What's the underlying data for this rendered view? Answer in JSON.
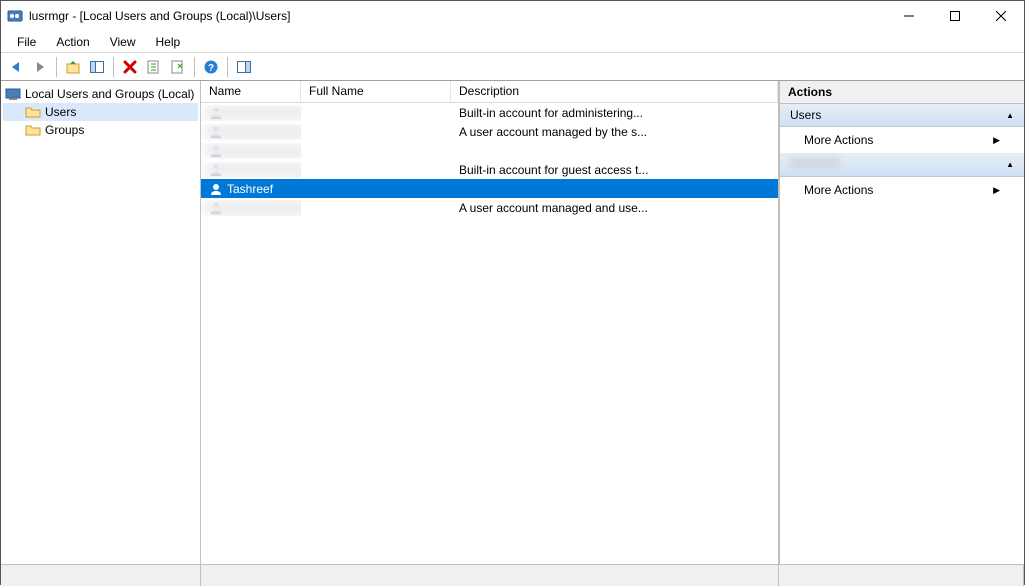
{
  "window": {
    "title": "lusrmgr - [Local Users and Groups (Local)\\Users]"
  },
  "menu": {
    "file": "File",
    "action": "Action",
    "view": "View",
    "help": "Help"
  },
  "tree": {
    "root": "Local Users and Groups (Local)",
    "users": "Users",
    "groups": "Groups"
  },
  "columns": {
    "name": "Name",
    "full": "Full Name",
    "desc": "Description"
  },
  "rows": [
    {
      "name": "",
      "full": "",
      "desc": "Built-in account for administering...",
      "blurred": true,
      "selected": false
    },
    {
      "name": "",
      "full": "",
      "desc": "A user account managed by the s...",
      "blurred": true,
      "selected": false
    },
    {
      "name": "",
      "full": "",
      "desc": "",
      "blurred": true,
      "selected": false
    },
    {
      "name": "",
      "full": "",
      "desc": "Built-in account for guest access t...",
      "blurred": true,
      "selected": false
    },
    {
      "name": "Tashreef",
      "full": "",
      "desc": "",
      "blurred": false,
      "selected": true
    },
    {
      "name": "",
      "full": "",
      "desc": "A user account managed and use...",
      "blurred": true,
      "selected": false
    }
  ],
  "actions": {
    "header": "Actions",
    "group1": "Users",
    "more": "More Actions",
    "group2_blurred": true
  }
}
